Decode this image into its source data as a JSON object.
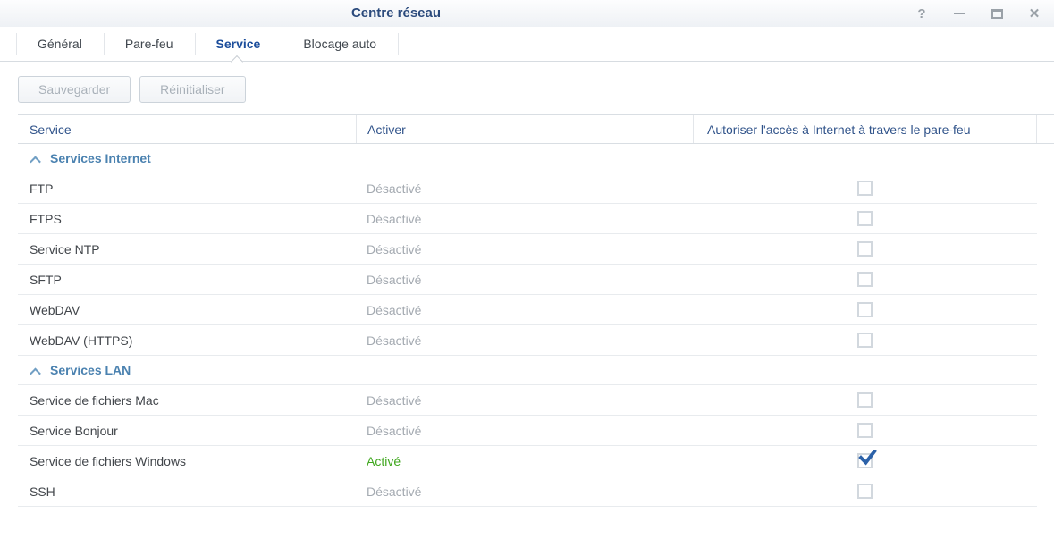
{
  "window": {
    "title": "Centre réseau",
    "controls": {
      "help": "?",
      "minimize": "—",
      "maximize": "▢",
      "close": "✕"
    }
  },
  "tabs": [
    {
      "label": "Général",
      "active": false
    },
    {
      "label": "Pare-feu",
      "active": false
    },
    {
      "label": "Service",
      "active": true
    },
    {
      "label": "Blocage auto",
      "active": false
    }
  ],
  "toolbar": {
    "save_label": "Sauvegarder",
    "reset_label": "Réinitialiser"
  },
  "table": {
    "columns": [
      "Service",
      "Activer",
      "Autoriser l'accès à Internet à travers le pare-feu"
    ],
    "sections": [
      {
        "title": "Services Internet",
        "collapsed": false,
        "rows": [
          {
            "service": "FTP",
            "status": "Désactivé",
            "enabled": false,
            "firewall_allowed": false
          },
          {
            "service": "FTPS",
            "status": "Désactivé",
            "enabled": false,
            "firewall_allowed": false
          },
          {
            "service": "Service NTP",
            "status": "Désactivé",
            "enabled": false,
            "firewall_allowed": false
          },
          {
            "service": "SFTP",
            "status": "Désactivé",
            "enabled": false,
            "firewall_allowed": false
          },
          {
            "service": "WebDAV",
            "status": "Désactivé",
            "enabled": false,
            "firewall_allowed": false
          },
          {
            "service": "WebDAV (HTTPS)",
            "status": "Désactivé",
            "enabled": false,
            "firewall_allowed": false
          }
        ]
      },
      {
        "title": "Services LAN",
        "collapsed": false,
        "rows": [
          {
            "service": "Service de fichiers Mac",
            "status": "Désactivé",
            "enabled": false,
            "firewall_allowed": false
          },
          {
            "service": "Service Bonjour",
            "status": "Désactivé",
            "enabled": false,
            "firewall_allowed": false
          },
          {
            "service": "Service de fichiers Windows",
            "status": "Activé",
            "enabled": true,
            "firewall_allowed": true
          },
          {
            "service": "SSH",
            "status": "Désactivé",
            "enabled": false,
            "firewall_allowed": false
          }
        ]
      }
    ]
  },
  "colors": {
    "title_text": "#2b4a7c",
    "active_tab": "#1b4d9b",
    "section_header": "#4b82b0",
    "status_enabled": "#3fa71e",
    "status_disabled": "#a4aab1",
    "checkbox_check": "#2c62a9"
  }
}
